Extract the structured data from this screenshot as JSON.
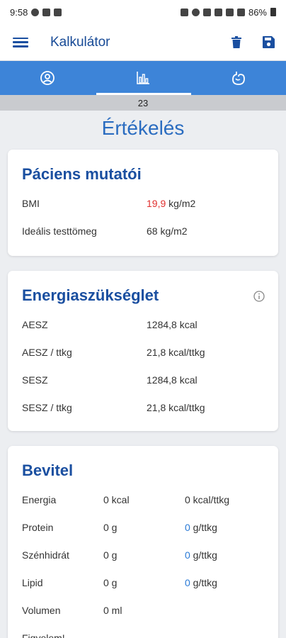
{
  "status": {
    "time": "9:58",
    "battery": "86%"
  },
  "appbar": {
    "title": "Kalkulátor"
  },
  "tabs": [
    {
      "name": "patient",
      "icon": "patient-face-icon"
    },
    {
      "name": "results",
      "icon": "bar-chart-icon"
    },
    {
      "name": "stomach",
      "icon": "stomach-icon"
    }
  ],
  "pager": {
    "value": "23"
  },
  "page_title": "Értékelés",
  "patient": {
    "title": "Páciens mutatói",
    "bmi_label": "BMI",
    "bmi_value": "19,9",
    "bmi_unit": " kg/m2",
    "ideal_label": "Ideális testtömeg",
    "ideal_value": "68 kg/m2"
  },
  "energy": {
    "title": "Energiaszükséglet",
    "rows": [
      {
        "label": "AESZ",
        "value": "1284,8 kcal"
      },
      {
        "label": "AESZ / ttkg",
        "value": "21,8 kcal/ttkg"
      },
      {
        "label": "SESZ",
        "value": "1284,8 kcal"
      },
      {
        "label": "SESZ / ttkg",
        "value": "21,8 kcal/ttkg"
      }
    ]
  },
  "intake": {
    "title": "Bevitel",
    "rows": [
      {
        "label": "Energia",
        "value": "0 kcal",
        "per_num": "",
        "per_unit": "0 kcal/ttkg"
      },
      {
        "label": "Protein",
        "value": "0 g",
        "per_num": "0",
        "per_unit": " g/ttkg"
      },
      {
        "label": "Szénhidrát",
        "value": "0 g",
        "per_num": "0",
        "per_unit": " g/ttkg"
      },
      {
        "label": "Lipid",
        "value": "0 g",
        "per_num": "0",
        "per_unit": " g/ttkg"
      },
      {
        "label": "Volumen",
        "value": "0 ml",
        "per_num": "",
        "per_unit": ""
      }
    ],
    "warning": "Figyelem!"
  },
  "colors": {
    "primary": "#1a4fa0",
    "tabbar": "#3d84d8",
    "accent_red": "#e0302f",
    "accent_blue": "#2a7ad6"
  }
}
